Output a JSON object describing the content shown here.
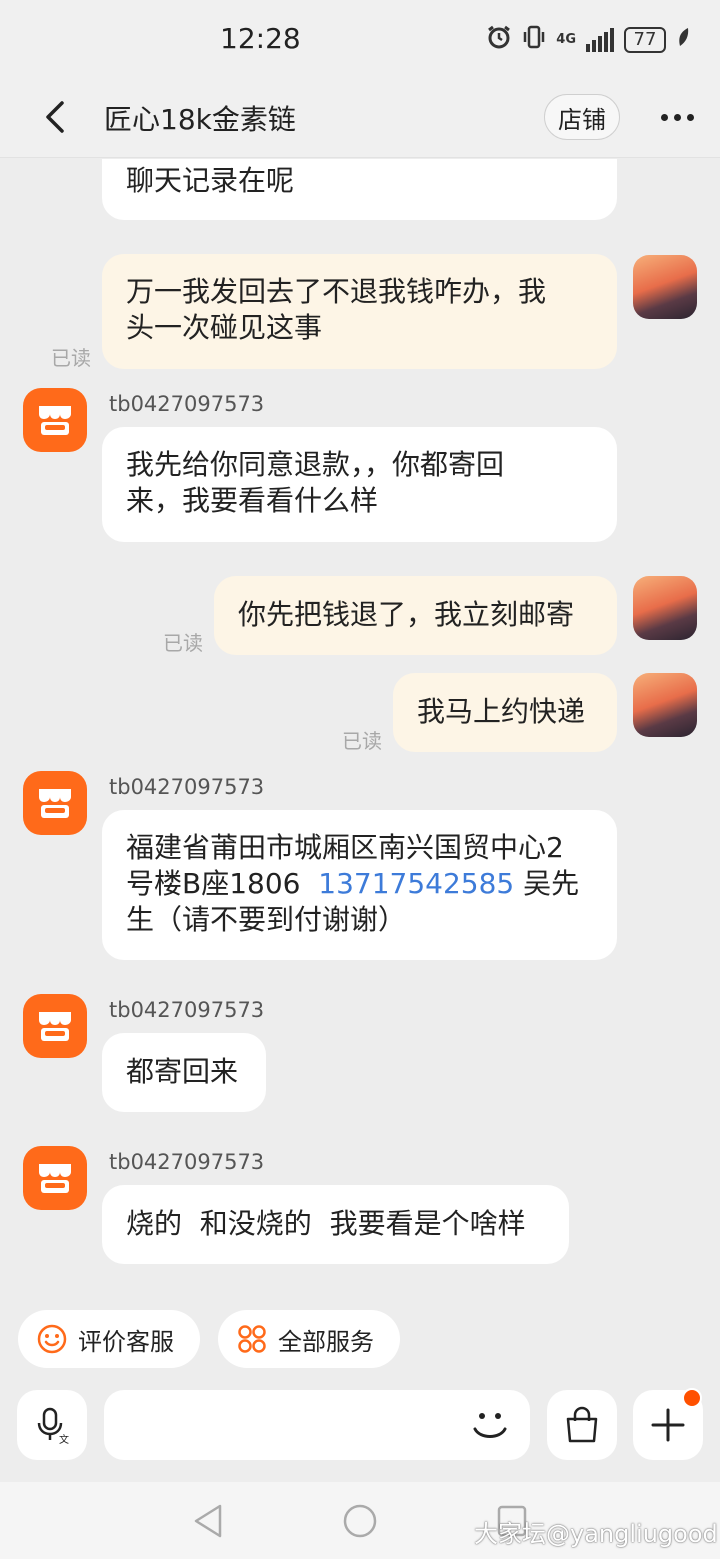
{
  "status_bar": {
    "time": "12:28",
    "network": "4G",
    "battery": "77",
    "icons": [
      "alarm-icon",
      "vibrate-icon",
      "signal-icon",
      "battery-icon",
      "leaf-icon"
    ]
  },
  "header": {
    "title": "匠心18k金素链",
    "store_button": "店铺",
    "back_icon": "chevron-left-icon",
    "more_icon": "more-dots-icon"
  },
  "messages": [
    {
      "sender": "me",
      "text": "聊天记录在呢",
      "partial_top": "……"
    },
    {
      "sender": "me",
      "line1": "万一我发回去了不退我钱咋办，我",
      "line2": "头一次碰见这事",
      "read": "已读"
    },
    {
      "sender": "shop",
      "nick": "tb0427097573",
      "line1": "我先给你同意退款，，你都寄回",
      "line2": "来，我要看看什么样"
    },
    {
      "sender": "me",
      "text": "你先把钱退了，我立刻邮寄",
      "read": "已读"
    },
    {
      "sender": "me",
      "text": "我马上约快递",
      "read": "已读"
    },
    {
      "sender": "shop",
      "nick": "tb0427097573",
      "line1": "福建省莆田市城厢区南兴国贸中心2",
      "line2_a": "号楼B座1806  ",
      "line2_phone": "13717542585",
      "line2_b": " 吴先",
      "line3": "生（请不要到付谢谢）"
    },
    {
      "sender": "shop",
      "nick": "tb0427097573",
      "text": "都寄回来"
    },
    {
      "sender": "shop",
      "nick": "tb0427097573",
      "text": "烧的  和没烧的  我要看是个啥样"
    }
  ],
  "quick_actions": [
    {
      "label": "评价客服",
      "icon": "smiley-icon"
    },
    {
      "label": "全部服务",
      "icon": "grid-icon"
    }
  ],
  "input_bar": {
    "placeholder": "",
    "icons": [
      "voice-input-icon",
      "emoji-icon",
      "shopping-bag-icon",
      "plus-icon"
    ]
  },
  "watermark": "大家坛@yangliugood",
  "colors": {
    "accent": "#ff6a1a",
    "link": "#3d7bd9",
    "my_bubble": "#fdf5e6",
    "background": "#ededed"
  }
}
